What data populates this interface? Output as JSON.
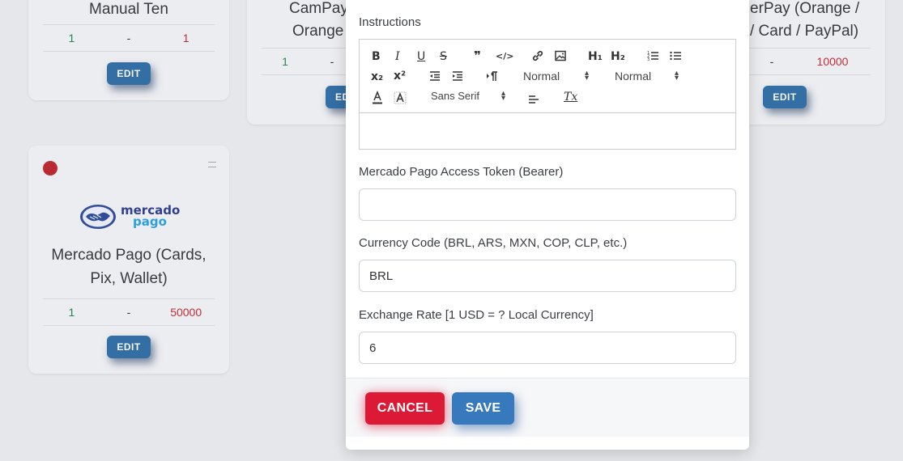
{
  "background": {
    "cards": [
      {
        "title": "Manual Ten",
        "stats": [
          "1",
          "-",
          "1"
        ],
        "edit_label": "EDIT"
      },
      {
        "title_line1": "CamPay",
        "title_line2": "Orange",
        "stats": [
          "1",
          "-"
        ],
        "edit_label": "ED"
      },
      {
        "title_line1": "erPay (Orange /",
        "title_line2": "/ Card / PayPal)",
        "stats": [
          "-",
          "10000"
        ],
        "edit_label": "EDIT"
      },
      {
        "title_line1": "Mercado Pago (Cards,",
        "title_line2": "Pix, Wallet)",
        "logo_word1": "mercado",
        "logo_word2": "pago",
        "stats": [
          "1",
          "-",
          "50000"
        ],
        "edit_label": "EDIT",
        "status_color": "#c0262f",
        "menu_icon": "drag-handle-icon"
      }
    ]
  },
  "modal": {
    "instructions_label": "Instructions",
    "toolbar": {
      "bold": "B",
      "italic": "I",
      "underline": "U",
      "strike": "S",
      "blockquote": "❞",
      "code": "</>",
      "h1": "H₁",
      "h2": "H₂",
      "subscript": "x₂",
      "superscript": "x²",
      "header_select": "Normal",
      "size_select": "Normal",
      "font_select": "Sans Serif",
      "clear_format": "Tx"
    },
    "editor_content": "",
    "token_label": "Mercado Pago Access Token (Bearer)",
    "token_value": "",
    "currency_label": "Currency Code (BRL, ARS, MXN, COP, CLP, etc.)",
    "currency_value": "BRL",
    "rate_label": "Exchange Rate [1 USD = ? Local Currency]",
    "rate_value": "6",
    "cancel_label": "CANCEL",
    "save_label": "SAVE"
  },
  "colors": {
    "cancel": "#dc1a35",
    "save": "#3679bd",
    "edit": "#2f6ea6",
    "stat_green": "#1f8a4c",
    "stat_red": "#c72a36"
  }
}
